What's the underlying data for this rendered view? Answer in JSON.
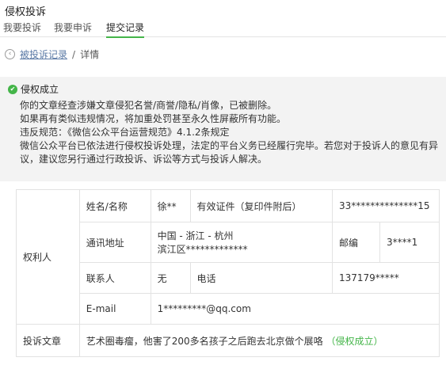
{
  "page_title": "侵权投诉",
  "tabs": [
    "我要投诉",
    "我要申诉",
    "提交记录"
  ],
  "breadcrumb": {
    "link": "被投诉记录",
    "sep": "/",
    "current": "详情"
  },
  "notice": {
    "status": "侵权成立",
    "lines": [
      "你的文章经查涉嫌文章侵犯名誉/商誉/隐私/肖像，已被删除。",
      "如果再有类似违规情况，将加重处罚甚至永久性屏蔽所有功能。",
      "违反规范：《微信公众平台运营规范》4.1.2条规定",
      "微信公众平台已依法进行侵权投诉处理，法定的平台义务已经履行完毕。若您对于投诉人的意见有异议，建议您另行通过行政投诉、诉讼等方式与投诉人解决。"
    ]
  },
  "table": {
    "section_label": "权利人",
    "name_label": "姓名/名称",
    "name_value": "徐**",
    "id_label": "有效证件（复印件附后）",
    "id_value": "33**************15",
    "address_label": "通讯地址",
    "address_line1": "中国 - 浙江 - 杭州",
    "address_line2": "滨江区*************",
    "postcode_label": "邮编",
    "postcode_value": "3****1",
    "contact_label": "联系人",
    "contact_value": "无",
    "phone_label": "电话",
    "phone_value": "137179*****",
    "email_label": "E-mail",
    "email_value": "1*********@qq.com",
    "article_label": "投诉文章",
    "article_title": "艺术圈毒瘤，他害了200多名孩子之后跑去北京做个展咯",
    "article_status": "（侵权成立）"
  }
}
